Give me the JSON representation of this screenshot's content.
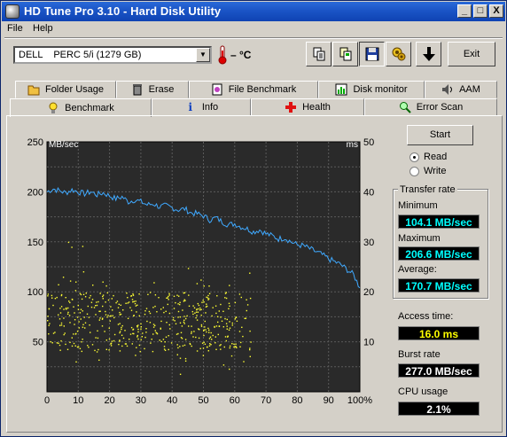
{
  "window": {
    "title": "HD Tune Pro 3.10 - Hard Disk Utility",
    "caption_buttons": [
      "_",
      "□",
      "X"
    ]
  },
  "menu": [
    "File",
    "Help"
  ],
  "toolbar": {
    "drive": "DELL    PERC 5/i (1279 GB)",
    "temperature": "– °C",
    "exit_label": "Exit",
    "icons": [
      "copy-icon",
      "copy-info-icon",
      "save-icon",
      "options-icon",
      "download-icon"
    ]
  },
  "tabs": {
    "row1": [
      "Folder Usage",
      "Erase",
      "File Benchmark",
      "Disk monitor",
      "AAM"
    ],
    "row2": [
      "Benchmark",
      "Info",
      "Health",
      "Error Scan"
    ],
    "active": "Benchmark"
  },
  "controls": {
    "start_label": "Start",
    "mode_options": [
      "Read",
      "Write"
    ],
    "mode_selected": "Read"
  },
  "transfer_rate": {
    "title": "Transfer rate",
    "minimum_label": "Minimum",
    "minimum_value": "104.1 MB/sec",
    "maximum_label": "Maximum",
    "maximum_value": "206.6 MB/sec",
    "average_label": "Average:",
    "average_value": "170.7 MB/sec"
  },
  "stats": {
    "access_label": "Access time:",
    "access_value": "16.0 ms",
    "burst_label": "Burst rate",
    "burst_value": "277.0 MB/sec",
    "cpu_label": "CPU usage",
    "cpu_value": "2.1%"
  },
  "colors": {
    "transfer_line": "#3fa9ff",
    "access_points": "#ffff33",
    "plot_bg": "#2a2a2a",
    "grid": "#5a5a5a"
  },
  "chart_data": {
    "type": "line",
    "left_unit": "MB/sec",
    "right_unit": "ms",
    "yleft_ticks": [
      "250",
      "200",
      "150",
      "100",
      "50"
    ],
    "yright_ticks": [
      "50",
      "40",
      "30",
      "20",
      "10"
    ],
    "x_ticks": [
      "0",
      "10",
      "20",
      "30",
      "40",
      "50",
      "60",
      "70",
      "80",
      "90",
      "100%"
    ],
    "xlim": [
      0,
      100
    ],
    "ylim_left": [
      0,
      250
    ],
    "ylim_right": [
      0,
      50
    ],
    "series": [
      {
        "unit": "MB/sec",
        "x": [
          0,
          2,
          4,
          6,
          8,
          10,
          12,
          14,
          16,
          18,
          20,
          22,
          24,
          26,
          28,
          30,
          32,
          34,
          36,
          38,
          40,
          42,
          44,
          46,
          48,
          50,
          52,
          54,
          56,
          58,
          60,
          62,
          64,
          66,
          68,
          70,
          72,
          74,
          76,
          78,
          80,
          82,
          84,
          86,
          88,
          90,
          92,
          94,
          96,
          98,
          100
        ],
        "values": [
          200,
          203,
          201,
          199,
          202,
          200,
          198,
          200,
          197,
          199,
          196,
          193,
          195,
          190,
          192,
          190,
          187,
          188,
          185,
          186,
          184,
          182,
          183,
          179,
          178,
          176,
          172,
          174,
          170,
          167,
          168,
          165,
          163,
          160,
          162,
          158,
          156,
          153,
          154,
          150,
          147,
          146,
          143,
          140,
          137,
          133,
          130,
          127,
          122,
          117,
          104
        ]
      }
    ],
    "access_time_ms_note": "scatter of access times (right axis) mostly between 5 and 20 ms for 0–65% of disk"
  }
}
